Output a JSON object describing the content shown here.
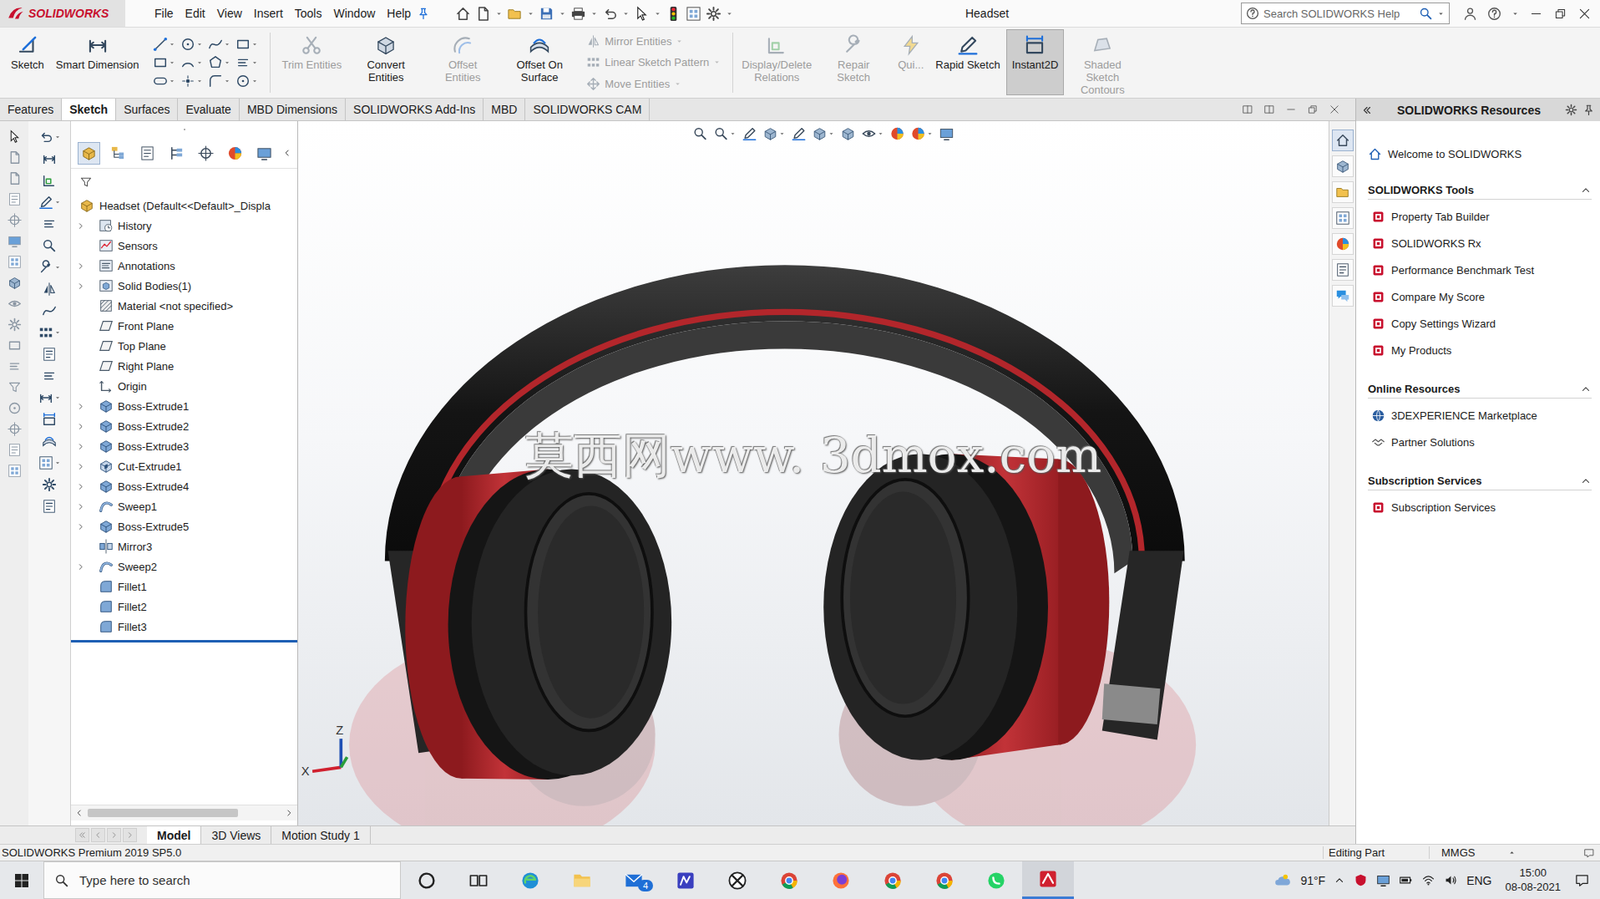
{
  "window": {
    "title": "Headset",
    "logo": "SOLIDWORKS"
  },
  "menu": [
    "File",
    "Edit",
    "View",
    "Insert",
    "Tools",
    "Window",
    "Help"
  ],
  "search": {
    "placeholder": "Search SOLIDWORKS Help"
  },
  "ribbon": {
    "primary": [
      {
        "label": "Sketch",
        "disabled": false,
        "selected": false
      },
      {
        "label": "Smart Dimension",
        "disabled": false,
        "selected": false
      }
    ],
    "edit": [
      {
        "label": "Trim Entities",
        "disabled": true,
        "selected": false
      },
      {
        "label": "Convert Entities",
        "disabled": false,
        "selected": false
      },
      {
        "label": "Offset Entities",
        "disabled": true,
        "selected": false
      },
      {
        "label": "Offset On Surface",
        "disabled": false,
        "selected": false
      }
    ],
    "stack": [
      {
        "label": "Mirror Entities",
        "disabled": true,
        "selected": false
      },
      {
        "label": "Linear Sketch Pattern",
        "disabled": true,
        "selected": false
      },
      {
        "label": "Move Entities",
        "disabled": true,
        "selected": false
      }
    ],
    "relations": [
      {
        "label": "Display/Delete Relations",
        "disabled": true,
        "selected": false
      },
      {
        "label": "Repair Sketch",
        "disabled": true,
        "selected": false
      },
      {
        "label": "Qui...",
        "disabled": true,
        "selected": false
      },
      {
        "label": "Rapid Sketch",
        "disabled": false,
        "selected": false
      },
      {
        "label": "Instant2D",
        "disabled": false,
        "selected": true
      },
      {
        "label": "Shaded Sketch Contours",
        "disabled": true,
        "selected": false
      }
    ]
  },
  "tabs": [
    {
      "label": "Features",
      "selected": false
    },
    {
      "label": "Sketch",
      "selected": true
    },
    {
      "label": "Surfaces",
      "selected": false
    },
    {
      "label": "Evaluate",
      "selected": false
    },
    {
      "label": "MBD Dimensions",
      "selected": false
    },
    {
      "label": "SOLIDWORKS Add-Ins",
      "selected": false
    },
    {
      "label": "MBD",
      "selected": false
    },
    {
      "label": "SOLIDWORKS CAM",
      "selected": false
    }
  ],
  "tree": {
    "root": "Headset (Default<<Default>_Displa",
    "items": [
      {
        "label": "History",
        "kind": "history",
        "expandable": true,
        "expanded": false
      },
      {
        "label": "Sensors",
        "kind": "sensor",
        "expandable": false,
        "expanded": false
      },
      {
        "label": "Annotations",
        "kind": "annotation",
        "expandable": true,
        "expanded": false
      },
      {
        "label": "Solid Bodies(1)",
        "kind": "bodies",
        "expandable": true,
        "expanded": false
      },
      {
        "label": "Material <not specified>",
        "kind": "material",
        "expandable": false,
        "expanded": false
      },
      {
        "label": "Front Plane",
        "kind": "plane",
        "expandable": false,
        "expanded": false
      },
      {
        "label": "Top Plane",
        "kind": "plane",
        "expandable": false,
        "expanded": false
      },
      {
        "label": "Right Plane",
        "kind": "plane",
        "expandable": false,
        "expanded": false
      },
      {
        "label": "Origin",
        "kind": "origin",
        "expandable": false,
        "expanded": false
      },
      {
        "label": "Boss-Extrude1",
        "kind": "extrude",
        "expandable": true,
        "expanded": false
      },
      {
        "label": "Boss-Extrude2",
        "kind": "extrude",
        "expandable": true,
        "expanded": false
      },
      {
        "label": "Boss-Extrude3",
        "kind": "extrude",
        "expandable": true,
        "expanded": false
      },
      {
        "label": "Cut-Extrude1",
        "kind": "cut",
        "expandable": true,
        "expanded": false
      },
      {
        "label": "Boss-Extrude4",
        "kind": "extrude",
        "expandable": true,
        "expanded": false
      },
      {
        "label": "Sweep1",
        "kind": "sweep",
        "expandable": true,
        "expanded": false
      },
      {
        "label": "Boss-Extrude5",
        "kind": "extrude",
        "expandable": true,
        "expanded": false
      },
      {
        "label": "Mirror3",
        "kind": "mirror",
        "expandable": false,
        "expanded": false
      },
      {
        "label": "Sweep2",
        "kind": "sweep",
        "expandable": true,
        "expanded": false
      },
      {
        "label": "Fillet1",
        "kind": "fillet",
        "expandable": false,
        "expanded": false
      },
      {
        "label": "Fillet2",
        "kind": "fillet",
        "expandable": false,
        "expanded": false
      },
      {
        "label": "Fillet3",
        "kind": "fillet",
        "expandable": false,
        "expanded": false
      }
    ],
    "hscroll_level": 0.78
  },
  "viewport": {
    "watermark": "莫西网www. 3dmox.com",
    "triad": {
      "x": "X",
      "z": "Z"
    }
  },
  "resources": {
    "title": "SOLIDWORKS Resources",
    "welcome": "Welcome to SOLIDWORKS",
    "sections": [
      {
        "title": "SOLIDWORKS Tools",
        "expanded": true,
        "items": [
          "Property Tab Builder",
          "SOLIDWORKS Rx",
          "Performance Benchmark Test",
          "Compare My Score",
          "Copy Settings Wizard",
          "My Products"
        ]
      },
      {
        "title": "Online Resources",
        "expanded": true,
        "items": [
          "3DEXPERIENCE Marketplace",
          "Partner Solutions"
        ]
      },
      {
        "title": "Subscription Services",
        "expanded": true,
        "items": [
          "Subscription Services"
        ]
      }
    ]
  },
  "bottom_tabs": [
    {
      "label": "Model",
      "selected": true
    },
    {
      "label": "3D Views",
      "selected": false
    },
    {
      "label": "Motion Study 1",
      "selected": false
    }
  ],
  "status_bar": {
    "product": "SOLIDWORKS Premium 2019 SP5.0",
    "mode": "Editing Part",
    "units": "MMGS"
  },
  "taskbar": {
    "search_placeholder": "Type here to search",
    "mail_badge": "4",
    "temperature": "91°F",
    "language": "ENG",
    "time": "15:00",
    "date": "08-08-2021"
  }
}
